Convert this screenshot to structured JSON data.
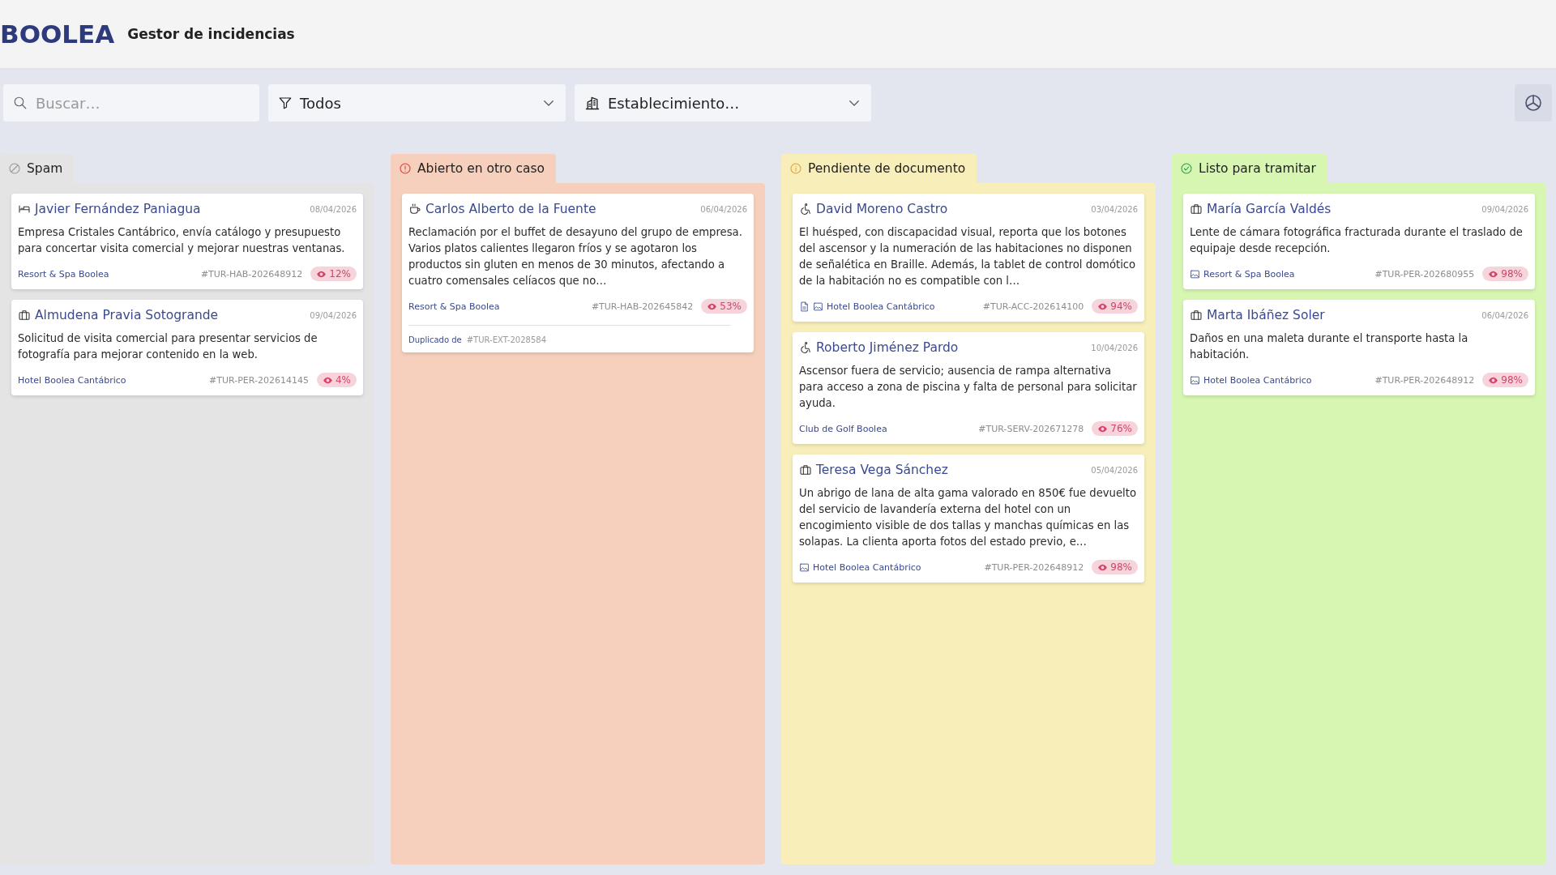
{
  "header": {
    "logo": "BOOLEA",
    "title": "Gestor de incidencias"
  },
  "filters": {
    "search": {
      "placeholder": "Buscar…"
    },
    "status": {
      "value": "Todos"
    },
    "establishment": {
      "placeholder": "Establecimiento…"
    }
  },
  "columns": [
    {
      "title": "Spam",
      "kind": "spam",
      "color": "#e4e4e4",
      "cards": [
        {
          "kind": "bed",
          "name": "Javier Fernández Paniagua",
          "date": "08/04/2026",
          "text": "Empresa Cristales Cantábrico, envía catálogo y presupuesto para concertar visita comercial y mejorar nuestras ventanas.",
          "establishment": "Resort & Spa Boolea",
          "code": "#TUR-HAB-202648912",
          "score": "12%"
        },
        {
          "kind": "luggage",
          "name": "Almudena Pravia Sotogrande",
          "date": "09/04/2026",
          "text": "Solicitud de visita comercial para presentar servicios de fotografía para mejorar contenido en la web.",
          "establishment": "Hotel Boolea Cantábrico",
          "code": "#TUR-PER-202614145",
          "score": "4%"
        }
      ]
    },
    {
      "title": "Abierto en otro caso",
      "kind": "error",
      "color": "#f6d0bc",
      "cards": [
        {
          "kind": "coffee",
          "name": "Carlos Alberto de la Fuente",
          "date": "06/04/2026",
          "text": "Reclamación por el buffet de desayuno del grupo de empresa. Varios platos calientes llegaron fríos y se agotaron los productos sin gluten en menos de 30 minutos, afectando a cuatro comensales celíacos que no…",
          "establishment": "Resort & Spa Boolea",
          "code": "#TUR-HAB-202645842",
          "score": "53%",
          "duplicate": {
            "label": "Duplicado de",
            "code": "#TUR-EXT-2028584"
          }
        }
      ]
    },
    {
      "title": "Pendiente de documento",
      "kind": "info",
      "color": "#f8eeb9",
      "cards": [
        {
          "kind": "accessibility",
          "name": "David Moreno Castro",
          "date": "03/04/2026",
          "text": "El huésped, con discapacidad visual, reporta que los botones del ascensor y la numeración de las habitaciones no disponen de señalética en Braille. Además, la tablet de control domótico de la habitación no es compatible con l…",
          "attachments": [
            {
              "kind": "document"
            },
            {
              "kind": "image"
            }
          ],
          "establishment": "Hotel Boolea Cantábrico",
          "code": "#TUR-ACC-202614100",
          "score": "94%"
        },
        {
          "kind": "accessibility",
          "name": "Roberto Jiménez Pardo",
          "date": "10/04/2026",
          "text": "Ascensor fuera de servicio; ausencia de rampa alternativa para acceso a zona de piscina y falta de personal para solicitar ayuda.",
          "establishment": "Club de Golf Boolea",
          "code": "#TUR-SERV-202671278",
          "score": "76%"
        },
        {
          "kind": "luggage",
          "name": "Teresa Vega Sánchez",
          "date": "05/04/2026",
          "text": "Un abrigo de lana de alta gama valorado en 850€ fue devuelto del servicio de lavandería externa del hotel con un encogimiento visible de dos tallas y manchas químicas en las solapas. La clienta aporta fotos del estado previo, e…",
          "attachments": [
            {
              "kind": "image"
            }
          ],
          "establishment": "Hotel Boolea Cantábrico",
          "code": "#TUR-PER-202648912",
          "score": "98%"
        }
      ]
    },
    {
      "title": "Listo para tramitar",
      "kind": "success",
      "color": "#d7f6b1",
      "cards": [
        {
          "kind": "luggage",
          "name": "María García Valdés",
          "date": "09/04/2026",
          "text": "Lente de cámara fotográfica fracturada durante el traslado de equipaje desde recepción.",
          "attachments": [
            {
              "kind": "image"
            }
          ],
          "establishment": "Resort & Spa Boolea",
          "code": "#TUR-PER-202680955",
          "score": "98%"
        },
        {
          "kind": "luggage",
          "name": "Marta Ibáñez Soler",
          "date": "06/04/2026",
          "text": "Daños en una maleta durante el transporte hasta la habitación.",
          "attachments": [
            {
              "kind": "image"
            }
          ],
          "establishment": "Hotel Boolea Cantábrico",
          "code": "#TUR-PER-202648912",
          "score": "98%"
        }
      ]
    }
  ]
}
